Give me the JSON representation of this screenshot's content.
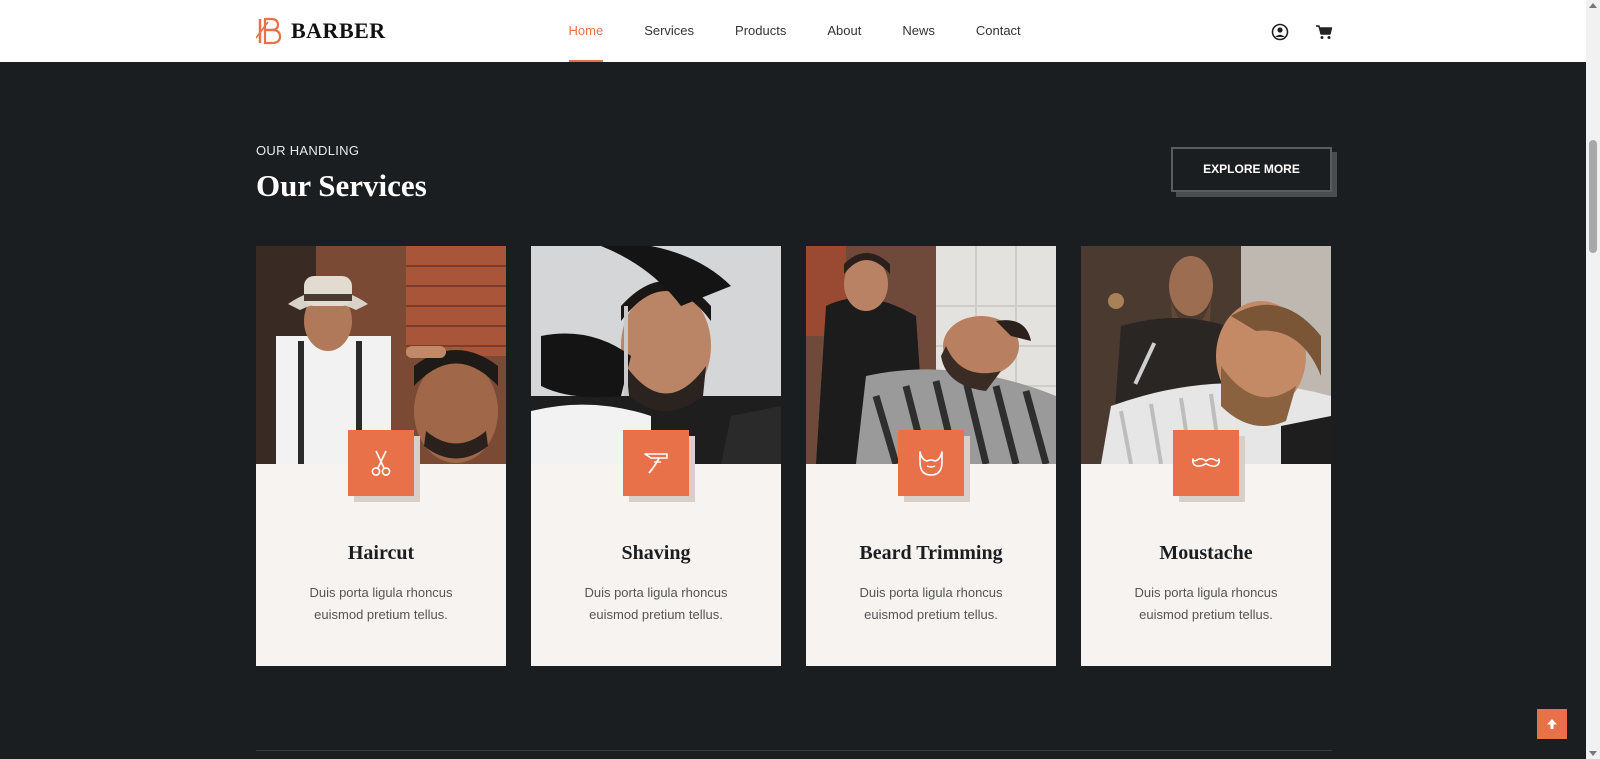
{
  "brand": {
    "name": "BARBER",
    "accent": "#e8714a",
    "logo_icon": "brand-b-logo"
  },
  "nav": {
    "items": [
      {
        "label": "Home",
        "active": true
      },
      {
        "label": "Services",
        "active": false
      },
      {
        "label": "Products",
        "active": false
      },
      {
        "label": "About",
        "active": false
      },
      {
        "label": "News",
        "active": false
      },
      {
        "label": "Contact",
        "active": false
      }
    ],
    "icons": [
      "user-account-icon",
      "shopping-cart-icon"
    ]
  },
  "section": {
    "eyebrow": "OUR HANDLING",
    "title": "Our Services",
    "explore_label": "EXPLORE MORE"
  },
  "services": [
    {
      "title": "Haircut",
      "desc": "Duis porta ligula rhoncus euismod pretium tellus.",
      "icon": "scissors-icon",
      "photo": "barber cutting client hair"
    },
    {
      "title": "Shaving",
      "desc": "Duis porta ligula rhoncus euismod pretium tellus.",
      "icon": "razor-icon",
      "photo": "barber shaving client with razor"
    },
    {
      "title": "Beard Trimming",
      "desc": "Duis porta ligula rhoncus euismod pretium tellus.",
      "icon": "beard-icon",
      "photo": "barber trimming client beard"
    },
    {
      "title": "Moustache",
      "desc": "Duis porta ligula rhoncus euismod pretium tellus.",
      "icon": "moustache-icon",
      "photo": "barber grooming client moustache"
    }
  ],
  "colors": {
    "background": "#1b1e21",
    "card": "#f7f3f0",
    "accent": "#e8714a"
  },
  "back_to_top_icon": "arrow-up-icon"
}
